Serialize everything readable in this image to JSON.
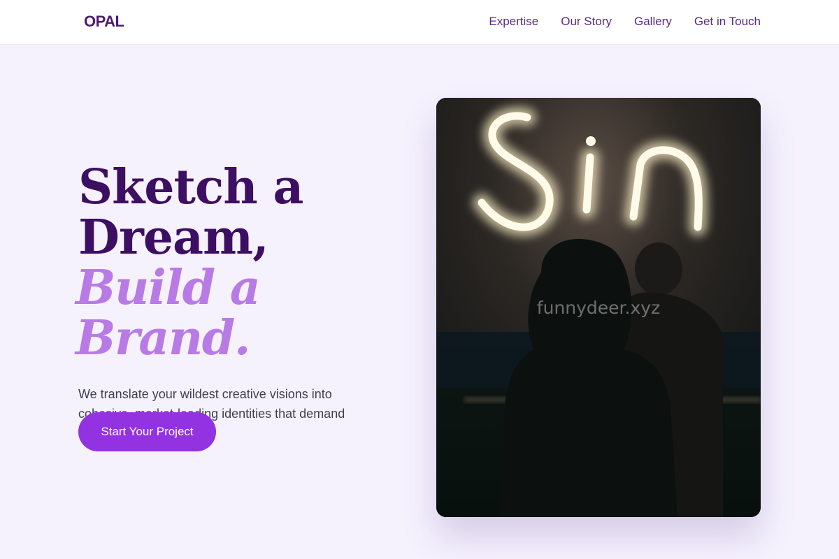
{
  "nav": {
    "brand": "OPAL",
    "links": [
      {
        "label": "Expertise"
      },
      {
        "label": "Our Story"
      },
      {
        "label": "Gallery"
      },
      {
        "label": "Get in Touch"
      }
    ]
  },
  "hero": {
    "headline_line1": "Sketch a",
    "headline_line2": "Dream,",
    "headline_accent": "Build a Brand.",
    "subtext": "We translate your wildest creative visions into cohesive, market-leading identities that demand attention.",
    "cta_label": "Start Your Project"
  },
  "image": {
    "neon_text": "Sin",
    "watermark": "funnydeer.xyz"
  },
  "colors": {
    "page_bg": "#f5f2fe",
    "headline": "#3d0f62",
    "accent": "#b87be6",
    "cta": "#9232e0",
    "nav_link": "#5b2a86"
  }
}
